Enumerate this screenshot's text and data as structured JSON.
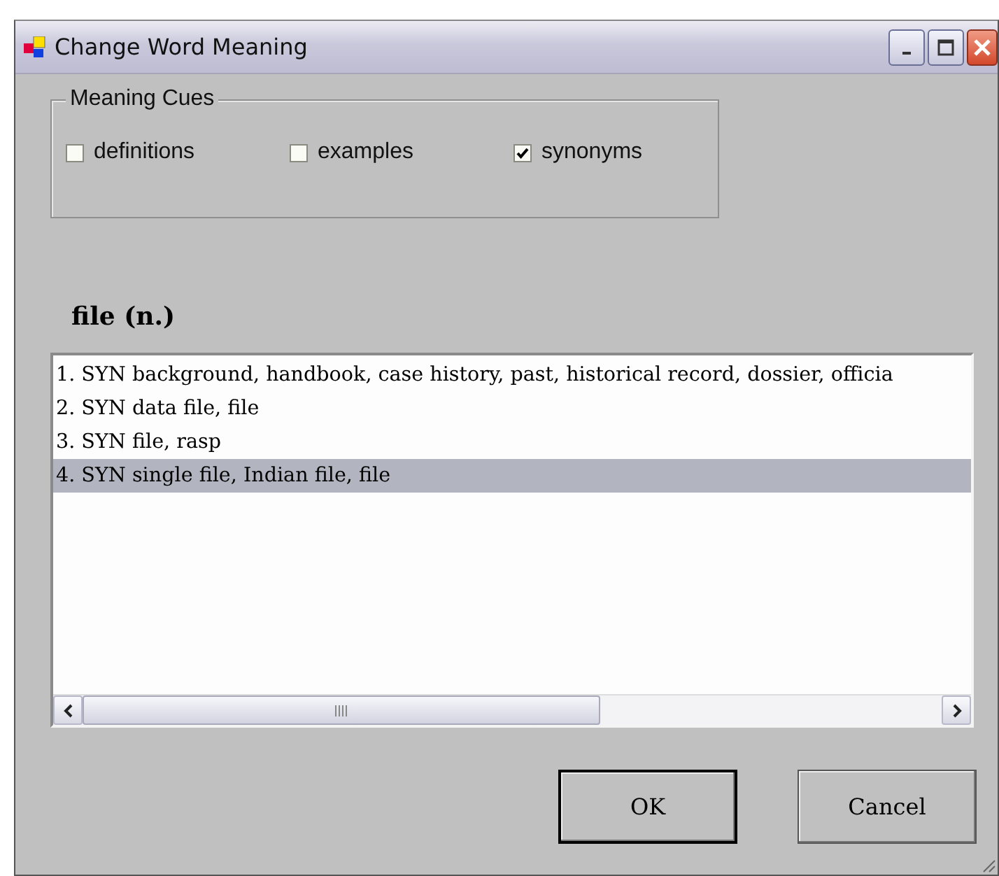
{
  "window": {
    "title": "Change Word Meaning"
  },
  "meaning_cues": {
    "title": "Meaning Cues",
    "options": [
      {
        "label": "definitions",
        "checked": false
      },
      {
        "label": "examples",
        "checked": false
      },
      {
        "label": "synonyms",
        "checked": true
      }
    ]
  },
  "heading": "file (n.)",
  "senses": [
    {
      "text": "1.  SYN background, handbook, case history, past, historical record, dossier, officia",
      "selected": false
    },
    {
      "text": "2.  SYN data file, file",
      "selected": false
    },
    {
      "text": "3.  SYN file, rasp",
      "selected": false
    },
    {
      "text": "4.  SYN single file, Indian file, file",
      "selected": true
    }
  ],
  "buttons": [
    {
      "label": "OK",
      "kind": "default"
    },
    {
      "label": "Cancel",
      "kind": "normal"
    }
  ]
}
